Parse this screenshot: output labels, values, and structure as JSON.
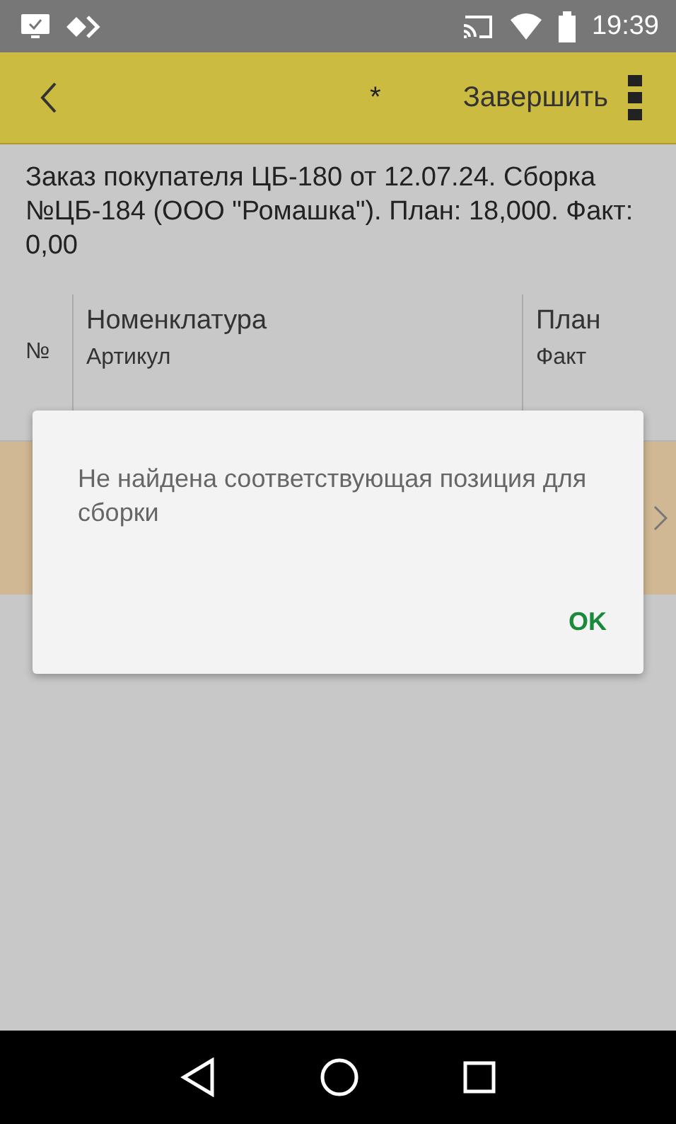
{
  "status_bar": {
    "time": "19:39"
  },
  "app_bar": {
    "title": "*",
    "action": "Завершить"
  },
  "document_title": "Заказ покупателя ЦБ-180 от 12.07.24. Сборка №ЦБ-184 (ООО \"Ромашка\"). План: 18,000. Факт: 0,00",
  "table": {
    "columns": [
      {
        "lines": [
          "№"
        ]
      },
      {
        "lines": [
          "Номенклатура",
          "Артикул"
        ]
      },
      {
        "lines": [
          "План",
          "Факт"
        ]
      }
    ],
    "rows": [
      {
        "selected": true
      }
    ]
  },
  "dialog": {
    "message": "Не найдена соответствующая позиция для сборки",
    "button": "OK"
  }
}
